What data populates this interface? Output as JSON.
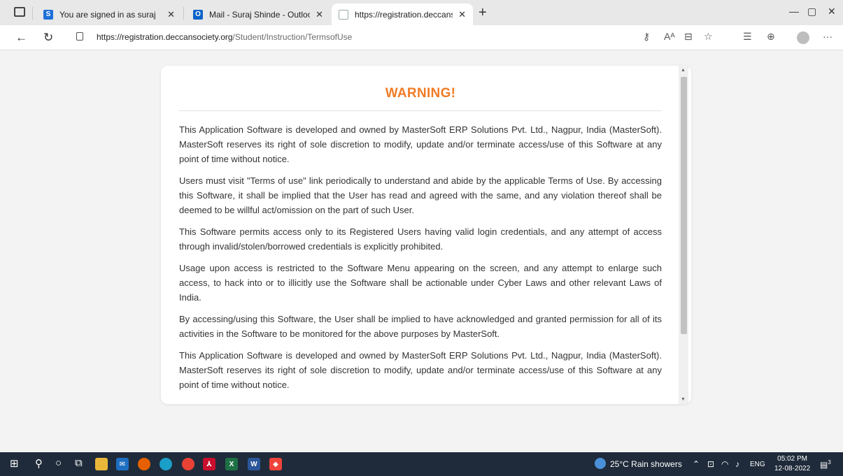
{
  "browser": {
    "tabs": [
      {
        "label": "You are signed in as suraj",
        "favicon": "S",
        "favicon_color": "#1e6fd9"
      },
      {
        "label": "Mail - Suraj Shinde - Outlook",
        "favicon": "O",
        "favicon_color": "#0a64c8"
      },
      {
        "label": "https://registration.deccansociety",
        "favicon": "",
        "favicon_color": "#ffffff"
      }
    ],
    "close_glyph": "✕",
    "new_tab": "+",
    "window": {
      "minimize": "—",
      "restore": "▢",
      "close": "✕"
    },
    "nav": {
      "back": "←",
      "refresh": "↻",
      "more": "···"
    },
    "url": {
      "host": "https://registration.deccansociety.org",
      "path": "/Student/Instruction/TermsofUse"
    },
    "icons": [
      "key-icon",
      "read-aloud-icon",
      "immersive-reader-icon",
      "favorite-star-icon",
      "favorites-list-icon",
      "collections-icon",
      "profile-icon",
      "menu-more-icon"
    ]
  },
  "page": {
    "title": "WARNING!",
    "paragraphs": [
      "This Application Software is developed and owned by MasterSoft ERP Solutions Pvt. Ltd., Nagpur, India (MasterSoft). MasterSoft reserves its right of sole discretion to modify, update and/or terminate access/use of this Software at any point of time without notice.",
      "Users must visit \"Terms of use\" link periodically to understand and abide by the applicable Terms of Use. By accessing this Software, it shall be implied that the User has read and agreed with the same, and any violation thereof shall be deemed to be willful act/omission on the part of such User.",
      "This Software permits access only to its Registered Users having valid login credentials, and any attempt of access through invalid/stolen/borrowed credentials is explicitly prohibited.",
      "Usage upon access is restricted to the Software Menu appearing on the screen, and any attempt to enlarge such access, to hack into or to illicitly use the Software shall be actionable under Cyber Laws and other relevant Laws of India.",
      "By accessing/using this Software, the User shall be implied to have acknowledged and granted permission for all of its activities in the Software to be monitored for the above purposes by MasterSoft.",
      "This Application Software is developed and owned by MasterSoft ERP Solutions Pvt. Ltd., Nagpur, India (MasterSoft). MasterSoft reserves its right of sole discretion to modify, update and/or terminate access/use of this Software at any point of time without notice."
    ],
    "accent_color": "#f07c26"
  },
  "taskbar": {
    "weather": "25°C  Rain showers",
    "lang": "ENG",
    "time": "05:02 PM",
    "date": "12-08-2022",
    "notification_count": "3",
    "apps": [
      "windows-start-icon",
      "search-icon",
      "cortana-icon",
      "task-view-icon",
      "file-explorer-icon",
      "mail-icon",
      "firefox-icon",
      "edge-icon",
      "chrome-icon",
      "acrobat-icon",
      "excel-icon",
      "word-icon",
      "anydesk-icon"
    ]
  }
}
